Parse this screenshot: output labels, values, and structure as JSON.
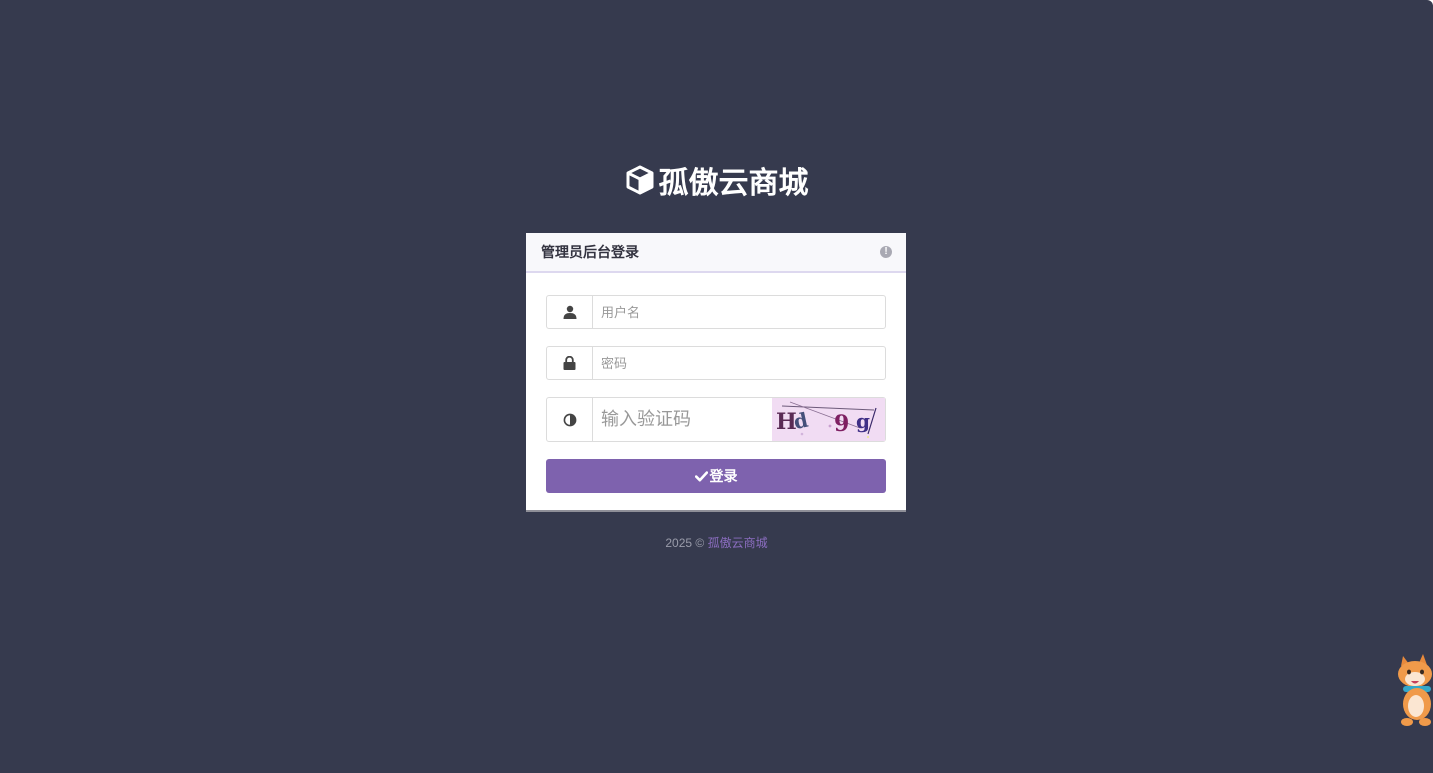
{
  "brand": {
    "name": "孤傲云商城",
    "icon": "cube-icon"
  },
  "login_panel": {
    "title": "管理员后台登录",
    "info_icon": "exclamation-circle-icon",
    "username": {
      "placeholder": "用户名",
      "value": "",
      "icon": "user-icon"
    },
    "password": {
      "placeholder": "密码",
      "value": "",
      "icon": "lock-icon"
    },
    "captcha": {
      "placeholder": "输入验证码",
      "value": "",
      "icon": "adjust-icon",
      "image_text": "Hd 9g"
    },
    "submit_label": "登录",
    "submit_icon": "check-icon",
    "accent_color": "#7e62ae"
  },
  "footer": {
    "year": "2025",
    "copyright_symbol": "©",
    "link_text": "孤傲云商城"
  },
  "mascot": {
    "icon": "fox-mascot-icon"
  }
}
